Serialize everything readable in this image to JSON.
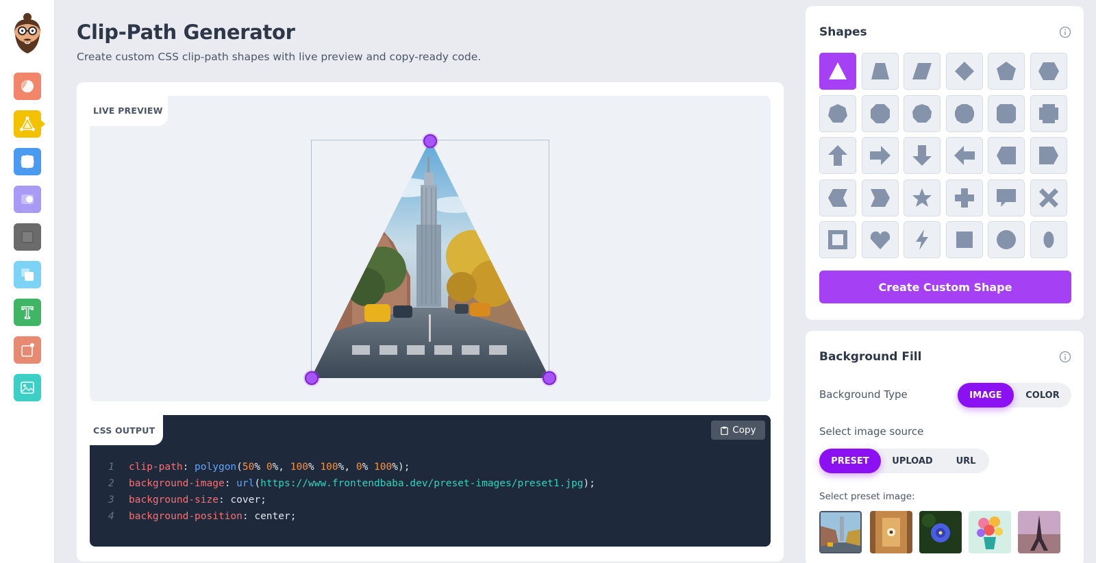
{
  "page": {
    "title": "Clip-Path Generator",
    "subtitle": "Create custom CSS clip-path shapes with live preview and copy-ready code."
  },
  "colors": {
    "accent": "#a540f5",
    "accent_dark": "#8b10f2",
    "code_bg": "#1e293b",
    "shape_fill": "#8493aa"
  },
  "sidebar": {
    "items": [
      {
        "name": "gradient-icon",
        "color": "#f2866a"
      },
      {
        "name": "clip-path-icon",
        "color": "#f2c200",
        "active": true
      },
      {
        "name": "border-radius-icon",
        "color": "#4a9af2"
      },
      {
        "name": "blob-icon",
        "color": "#a99af5"
      },
      {
        "name": "box-shadow-icon",
        "color": "#6b6b6b"
      },
      {
        "name": "layers-icon",
        "color": "#7dd3f5"
      },
      {
        "name": "text-icon",
        "color": "#3fb565"
      },
      {
        "name": "transform-icon",
        "color": "#e88a72"
      },
      {
        "name": "image-icon",
        "color": "#3ccfc6"
      }
    ]
  },
  "preview": {
    "label": "LIVE PREVIEW",
    "polygon": "50% 0%, 100% 100%, 0% 100%"
  },
  "output": {
    "label": "CSS OUTPUT",
    "copy_label": "Copy",
    "line_numbers": [
      "1",
      "2",
      "3",
      "4"
    ],
    "lines": {
      "l1_prop": "clip-path",
      "l1_fn": "polygon",
      "l1_args": [
        "50",
        "0",
        "100",
        "100",
        "0",
        "100"
      ],
      "l2_prop": "background-image",
      "l2_fn": "url",
      "l2_url": "https://www.frontendbaba.dev/preset-images/preset1.jpg",
      "l3_prop": "background-size",
      "l3_val": "cover",
      "l4_prop": "background-position",
      "l4_val": "center"
    }
  },
  "shapes": {
    "title": "Shapes",
    "items": [
      "triangle-icon",
      "trapezoid-icon",
      "parallelogram-icon",
      "rhombus-icon",
      "pentagon-icon",
      "hexagon-icon",
      "heptagon-icon",
      "octagon-icon",
      "nonagon-icon",
      "decagon-icon",
      "bevel-icon",
      "rabbet-icon",
      "arrow-up-icon",
      "arrow-right-icon",
      "arrow-down-icon",
      "arrow-left-icon",
      "point-left-icon",
      "point-right-icon",
      "chevron-left-icon",
      "chevron-right-icon",
      "star-icon",
      "cross-icon",
      "message-icon",
      "close-icon",
      "frame-icon",
      "heart-icon",
      "lightning-icon",
      "square-icon",
      "circle-icon",
      "ellipse-icon"
    ],
    "active_index": 0,
    "create_label": "Create Custom Shape"
  },
  "background": {
    "title": "Background Fill",
    "type_label": "Background Type",
    "type_options": [
      "IMAGE",
      "COLOR"
    ],
    "type_selected": "IMAGE",
    "source_label": "Select image source",
    "source_options": [
      "PRESET",
      "UPLOAD",
      "URL"
    ],
    "source_selected": "PRESET",
    "preset_label": "Select preset image:",
    "presets": [
      "city-street-thumbnail",
      "interior-thumbnail",
      "blue-flower-thumbnail",
      "flower-vase-thumbnail",
      "eiffel-tower-thumbnail"
    ],
    "preset_selected_index": 0
  }
}
